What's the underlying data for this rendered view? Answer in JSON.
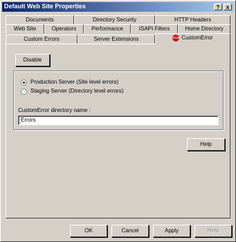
{
  "window": {
    "title": "Default Web Site Properties",
    "help_button": "?",
    "close_button": "x"
  },
  "tabs": {
    "row1": [
      "Documents",
      "Directory Security",
      "HTTP Headers"
    ],
    "row2": [
      "Web Site",
      "Operators",
      "Performance",
      "ISAPI Filters",
      "Home Directory"
    ],
    "row3": [
      "Custom Errors",
      "Server Extensions",
      "CustomError"
    ],
    "active": "CustomError",
    "active_icon": "stop-sign-icon",
    "active_icon_text": "STOP"
  },
  "panel": {
    "disable_button": "Disable",
    "options": [
      {
        "label": "Production Server (Site level errors)",
        "selected": true
      },
      {
        "label": "Staging Server (Directory level errors)",
        "selected": false
      }
    ],
    "directory_label": "CustomError directory name :",
    "directory_value": "Errors",
    "help_button": "Help"
  },
  "footer": {
    "ok": "OK",
    "cancel": "Cancel",
    "apply": "Apply",
    "help": "Help",
    "help_disabled": true
  },
  "colors": {
    "titlebar_start": "#0a246a",
    "titlebar_end": "#a6caf0",
    "face": "#d4d0c8",
    "stop_icon": "#cc1010"
  }
}
